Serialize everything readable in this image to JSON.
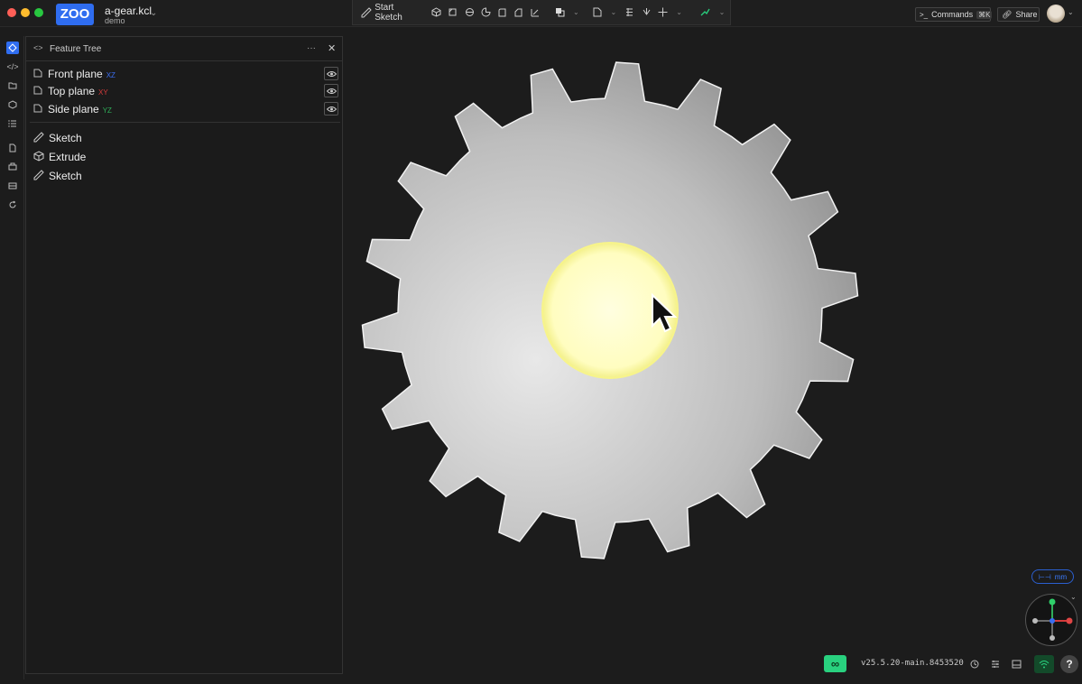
{
  "app": {
    "logo_text": "ZOO",
    "file_name": "a-gear.kcl",
    "project_name": "demo"
  },
  "toolbar": {
    "start_sketch_label": "Start Sketch",
    "icons": [
      "sketch-pencil-icon",
      "extrude-icon",
      "revolve-icon",
      "sweep-icon",
      "loft-icon",
      "fillet-icon",
      "chamfer-icon",
      "shell-icon",
      "boolean-icon",
      "plane-icon",
      "helix-icon",
      "transform-icon",
      "move-icon",
      "ai-icon"
    ]
  },
  "top_right": {
    "commands_label": "Commands",
    "commands_shortcut": "⌘K",
    "share_label": "Share"
  },
  "feature_tree": {
    "title": "Feature Tree",
    "planes": [
      {
        "label": "Front plane",
        "tag": "XZ",
        "tag_color": "#3b6df0"
      },
      {
        "label": "Top plane",
        "tag": "XY",
        "tag_color": "#d33b3b"
      },
      {
        "label": "Side plane",
        "tag": "YZ",
        "tag_color": "#2fae5a"
      }
    ],
    "features": [
      {
        "label": "Sketch",
        "icon": "sketch-icon"
      },
      {
        "label": "Extrude",
        "icon": "extrude-icon"
      },
      {
        "label": "Sketch",
        "icon": "sketch-icon"
      }
    ]
  },
  "viewport": {
    "unit_label": "mm",
    "gear_fill": "#c8c8c8",
    "hole_highlight": "#fffdc0"
  },
  "status": {
    "live_symbol": "∞",
    "version": "v25.5.20-main.8453520",
    "help_symbol": "?"
  }
}
